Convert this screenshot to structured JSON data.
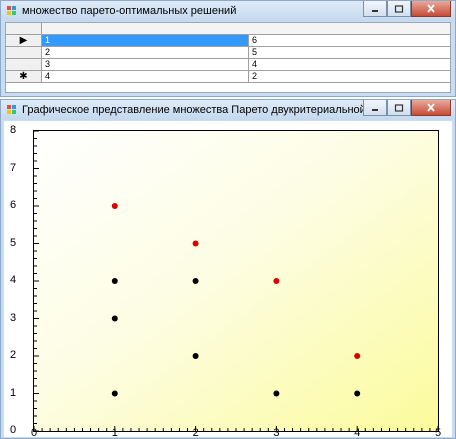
{
  "window1": {
    "title": "множество парето-оптимальных решений",
    "rows": [
      {
        "marker": "▶",
        "c1": "1",
        "c2": "6",
        "selected": true
      },
      {
        "marker": "",
        "c1": "2",
        "c2": "5",
        "selected": false
      },
      {
        "marker": "",
        "c1": "3",
        "c2": "4",
        "selected": false
      },
      {
        "marker": "✱",
        "c1": "4",
        "c2": "2",
        "selected": false
      }
    ]
  },
  "window2": {
    "title": "Графическое представление множества Парето двукритериальной задачи"
  },
  "chart_data": {
    "type": "scatter",
    "xlim": [
      0,
      5
    ],
    "ylim": [
      0,
      8
    ],
    "x_ticks": [
      "0",
      "1",
      "2",
      "3",
      "4",
      "5"
    ],
    "y_ticks": [
      "0",
      "1",
      "2",
      "3",
      "4",
      "5",
      "6",
      "7",
      "8"
    ],
    "series": [
      {
        "color": "#000000",
        "points": [
          [
            1,
            1
          ],
          [
            1,
            3
          ],
          [
            1,
            4
          ],
          [
            2,
            2
          ],
          [
            2,
            4
          ],
          [
            3,
            1
          ],
          [
            4,
            1
          ]
        ]
      },
      {
        "color": "#dd0000",
        "points": [
          [
            1,
            6
          ],
          [
            2,
            5
          ],
          [
            3,
            4
          ],
          [
            4,
            2
          ]
        ]
      }
    ],
    "background": "white-to-yellow gradient",
    "grid": false
  }
}
